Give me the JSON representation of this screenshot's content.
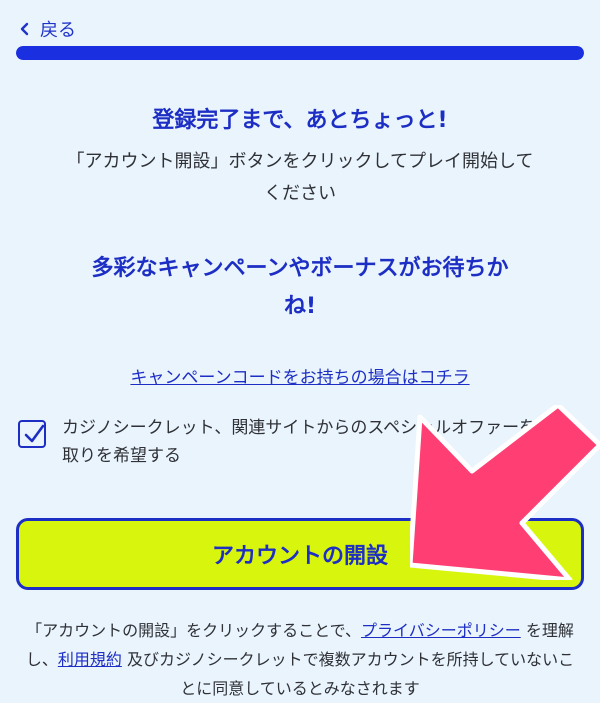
{
  "header": {
    "back_label": "戻る",
    "progress_fraction": 1.0
  },
  "content": {
    "title": "登録完了まで、あとちょっと!",
    "description": "「アカウント開設」ボタンをクリックしてプレイ開始してください",
    "promo_line1": "多彩なキャンペーンやボーナスがお待ちか",
    "promo_line2": "ね!",
    "campaign_code_link": "キャンペーンコードをお持ちの場合はコチラ"
  },
  "offer": {
    "checked": true,
    "label": "カジノシークレット、関連サイトからのスペシャルオファーを受け取りを希望する"
  },
  "cta": {
    "label": "アカウントの開設"
  },
  "legal": {
    "part1": "「アカウントの開設」をクリックすることで、",
    "privacy_link": "プライバシーポリシー",
    "part2": " を理解し、",
    "terms_link": "利用規約",
    "part3": " 及びカジノシークレットで複数アカウントを所持していないことに同意しているとみなされます"
  },
  "colors": {
    "background": "#e9f4fd",
    "primary_blue": "#1d2ec4",
    "cta_fill": "#d8f50e",
    "arrow_pink": "#ff3f74"
  }
}
